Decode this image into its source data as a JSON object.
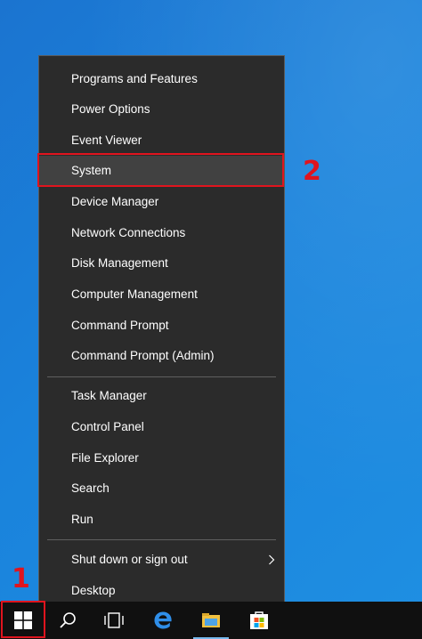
{
  "menu": {
    "group1": [
      {
        "label": "Programs and Features"
      },
      {
        "label": "Power Options"
      },
      {
        "label": "Event Viewer"
      },
      {
        "label": "System"
      },
      {
        "label": "Device Manager"
      },
      {
        "label": "Network Connections"
      },
      {
        "label": "Disk Management"
      },
      {
        "label": "Computer Management"
      },
      {
        "label": "Command Prompt"
      },
      {
        "label": "Command Prompt (Admin)"
      }
    ],
    "group2": [
      {
        "label": "Task Manager"
      },
      {
        "label": "Control Panel"
      },
      {
        "label": "File Explorer"
      },
      {
        "label": "Search"
      },
      {
        "label": "Run"
      }
    ],
    "group3": [
      {
        "label": "Shut down or sign out",
        "submenu": true
      },
      {
        "label": "Desktop"
      }
    ],
    "selected": "System"
  },
  "annotations": {
    "step1": "1",
    "step2": "2",
    "color": "#e0141e"
  },
  "taskbar": {
    "icons": [
      "windows-logo-icon",
      "search-icon",
      "task-view-icon",
      "edge-icon",
      "file-explorer-icon",
      "store-icon"
    ]
  },
  "colors": {
    "menu_bg": "#2b2b2b",
    "selected_bg": "#414141",
    "taskbar_bg": "#101010",
    "desktop_blue": "#1a83dc"
  }
}
